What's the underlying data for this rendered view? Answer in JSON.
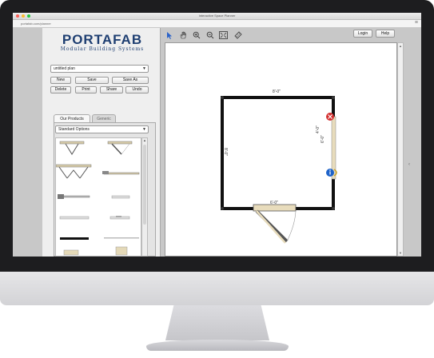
{
  "window": {
    "title": "Interactive Space Planner",
    "url": "portafab.com/planner",
    "menu_icon": "menu-icon"
  },
  "brand": {
    "name": "PORTAFAB",
    "tagline": "Modular Building Systems",
    "color": "#1f3f72"
  },
  "plan": {
    "name": "untitled plan"
  },
  "buttons": {
    "new": "New",
    "save": "Save",
    "save_as": "Save As",
    "delete": "Delete",
    "print": "Print",
    "share": "Share",
    "undo": "Undo"
  },
  "tabs": {
    "our_products": "Our Products",
    "generic": "Generic"
  },
  "options": {
    "selected": "Standard Options"
  },
  "header": {
    "login": "Login",
    "help": "Help"
  },
  "toolbar": [
    "select-arrow-icon",
    "pan-hand-icon",
    "zoom-in-icon",
    "zoom-out-icon",
    "fit-screen-icon",
    "measure-ruler-icon"
  ],
  "dimensions": {
    "top": "8'-0\"",
    "left": "8'-0\"",
    "right": "4'-0\"",
    "right_lower": "6'-0\"",
    "door": "6'-0\""
  },
  "colors": {
    "wall": "#111111",
    "door": "#e8dcbc",
    "delete_badge": "#d32f2f",
    "info_badge": "#1e63c9"
  }
}
